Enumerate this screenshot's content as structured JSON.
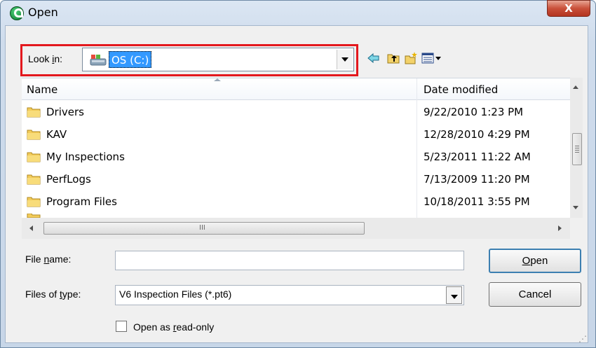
{
  "window": {
    "title": "Open",
    "close_label": "X"
  },
  "look_in": {
    "label_prefix": "Look ",
    "label_ul": "i",
    "label_suffix": "n:",
    "value": "OS (C:)"
  },
  "list": {
    "columns": {
      "name": "Name",
      "date": "Date modified"
    },
    "rows": [
      {
        "name": "Drivers",
        "date": "9/22/2010 1:23 PM"
      },
      {
        "name": "KAV",
        "date": "12/28/2010 4:29 PM"
      },
      {
        "name": "My Inspections",
        "date": "5/23/2011 11:22 AM"
      },
      {
        "name": "PerfLogs",
        "date": "7/13/2009 11:20 PM"
      },
      {
        "name": "Program Files",
        "date": "10/18/2011 3:55 PM"
      }
    ],
    "hscroll_grip": "III"
  },
  "file_name": {
    "label_prefix": "File ",
    "label_ul": "n",
    "label_suffix": "ame:",
    "value": ""
  },
  "file_type": {
    "label_prefix": "Files of ",
    "label_ul": "t",
    "label_suffix": "ype:",
    "value": "V6 Inspection Files (*.pt6)"
  },
  "buttons": {
    "open_ul": "O",
    "open_rest": "pen",
    "cancel": "Cancel"
  },
  "readonly": {
    "label_prefix": "Open as ",
    "label_ul": "r",
    "label_suffix": "ead-only"
  },
  "colors": {
    "highlight": "#e3181e",
    "selection": "#3399ff",
    "close": "#c9503a"
  }
}
